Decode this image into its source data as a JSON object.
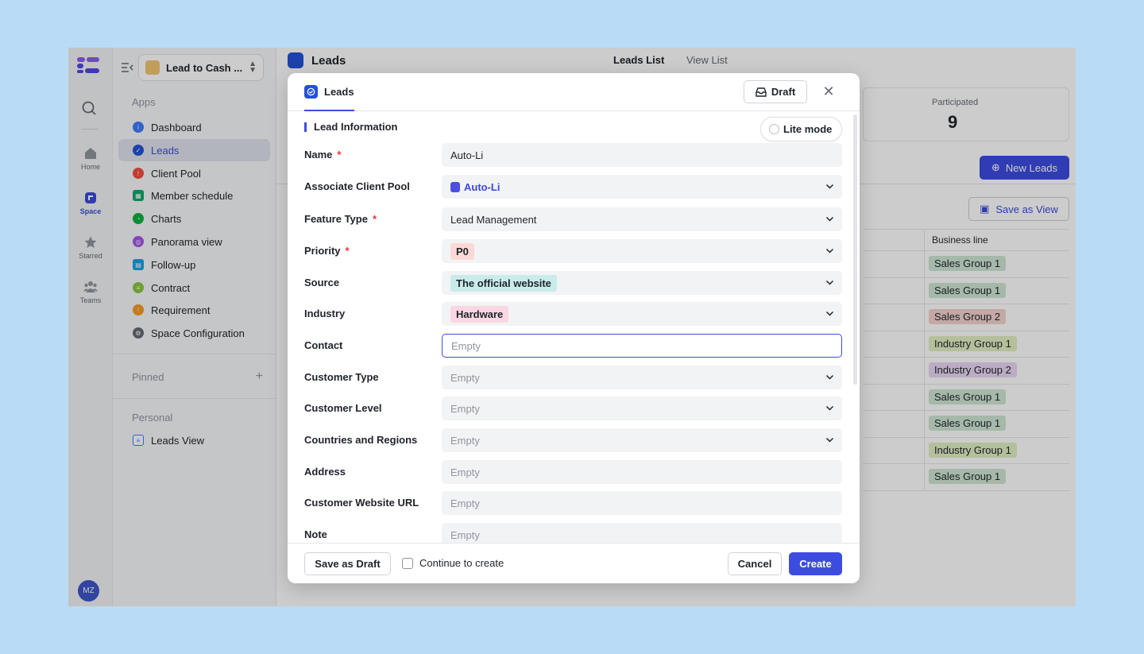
{
  "rail": {
    "items": [
      {
        "label": "Home"
      },
      {
        "label": "Space"
      },
      {
        "label": "Starred"
      },
      {
        "label": "Teams"
      }
    ],
    "avatar": "MZ"
  },
  "sidebar": {
    "space_name": "Lead to Cash ...",
    "apps_label": "Apps",
    "items": [
      {
        "label": "Dashboard",
        "color": "#3e7bfa"
      },
      {
        "label": "Leads",
        "color": "#2452d6"
      },
      {
        "label": "Client Pool",
        "color": "#f04e3e"
      },
      {
        "label": "Member schedule",
        "color": "#14a66b"
      },
      {
        "label": "Charts",
        "color": "#10b040"
      },
      {
        "label": "Panorama view",
        "color": "#a455e6"
      },
      {
        "label": "Follow-up",
        "color": "#1f9fe0"
      },
      {
        "label": "Contract",
        "color": "#8cc63f"
      },
      {
        "label": "Requirement",
        "color": "#f59a23"
      },
      {
        "label": "Space Configuration",
        "color": "#646a73"
      }
    ],
    "pinned_label": "Pinned",
    "personal_label": "Personal",
    "personal_items": [
      {
        "label": "Leads View"
      }
    ]
  },
  "main": {
    "title": "Leads",
    "tabs": [
      "Leads List",
      "View List"
    ],
    "stat_label": "Participated",
    "stat_value": "9",
    "new_button": "New Leads",
    "save_view": "Save as View",
    "table_header": "Business line",
    "rows": [
      {
        "tag": "Sales Group 1",
        "color": "#cfe7d4"
      },
      {
        "tag": "Sales Group 1",
        "color": "#cfe7d4"
      },
      {
        "tag": "Sales Group 2",
        "color": "#f5d2cf"
      },
      {
        "tag": "Industry Group 1",
        "color": "#e2efc4"
      },
      {
        "tag": "Industry Group 2",
        "color": "#ead7f4"
      },
      {
        "tag": "Sales Group 1",
        "color": "#cfe7d4"
      },
      {
        "tag": "Sales Group 1",
        "color": "#cfe7d4"
      },
      {
        "tag": "Industry Group 1",
        "color": "#e2efc4"
      },
      {
        "tag": "Sales Group 1",
        "color": "#cfe7d4"
      }
    ]
  },
  "modal": {
    "tab": "Leads",
    "draft": "Draft",
    "section": "Lead Information",
    "lite_mode": "Lite mode",
    "fields": [
      {
        "label": "Name",
        "required": "*",
        "value": "Auto-Li",
        "kind": "text"
      },
      {
        "label": "Associate Client Pool",
        "required": "",
        "value": "Auto-Li",
        "kind": "pool"
      },
      {
        "label": "Feature Type",
        "required": "*",
        "value": "Lead Management",
        "kind": "select"
      },
      {
        "label": "Priority",
        "required": "*",
        "value": "P0",
        "kind": "chip",
        "chip_color": "#fcd9d6"
      },
      {
        "label": "Source",
        "required": "",
        "value": "The official website",
        "kind": "chip",
        "chip_color": "#c9ece9"
      },
      {
        "label": "Industry",
        "required": "",
        "value": "Hardware",
        "kind": "chip",
        "chip_color": "#fad7e3"
      },
      {
        "label": "Contact",
        "required": "",
        "value": "Empty",
        "kind": "focus"
      },
      {
        "label": "Customer Type",
        "required": "",
        "value": "Empty",
        "kind": "select-empty"
      },
      {
        "label": "Customer Level",
        "required": "",
        "value": "Empty",
        "kind": "select-empty"
      },
      {
        "label": "Countries and Regions",
        "required": "",
        "value": "Empty",
        "kind": "select-empty"
      },
      {
        "label": "Address",
        "required": "",
        "value": "Empty",
        "kind": "empty"
      },
      {
        "label": "Customer Website URL",
        "required": "",
        "value": "Empty",
        "kind": "empty"
      },
      {
        "label": "Note",
        "required": "",
        "value": "Empty",
        "kind": "empty"
      }
    ],
    "footer": {
      "save_draft": "Save as Draft",
      "continue": "Continue to create",
      "cancel": "Cancel",
      "create": "Create"
    }
  }
}
